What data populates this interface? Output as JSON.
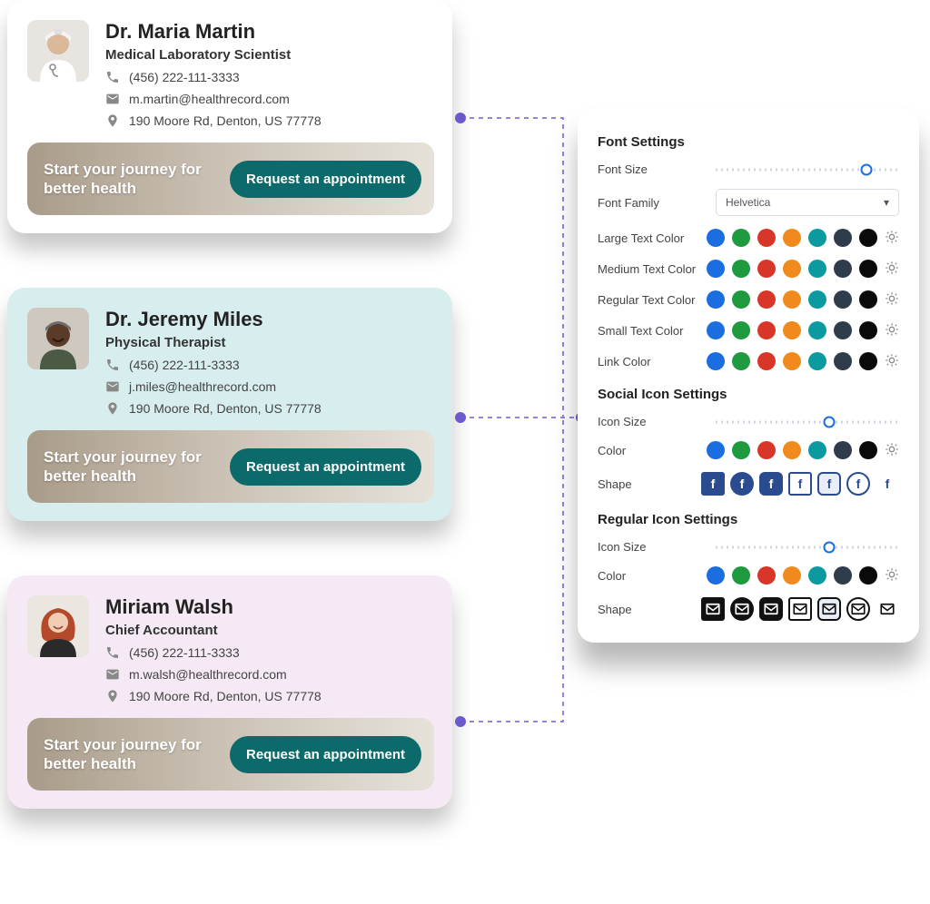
{
  "cards": [
    {
      "bg": "white",
      "name": "Dr. Maria Martin",
      "title": "Medical Laboratory Scientist",
      "phone": "(456) 222-111-3333",
      "email": "m.martin@healthrecord.com",
      "address": "190 Moore Rd, Denton, US 77778",
      "banner_tagline": "Start your journey for better health",
      "banner_cta": "Request an appointment"
    },
    {
      "bg": "blue",
      "name": "Dr. Jeremy Miles",
      "title": "Physical Therapist",
      "phone": "(456) 222-111-3333",
      "email": "j.miles@healthrecord.com",
      "address": "190 Moore Rd, Denton, US 77778",
      "banner_tagline": "Start your journey for better health",
      "banner_cta": "Request an appointment"
    },
    {
      "bg": "pink",
      "name": "Miriam Walsh",
      "title": "Chief Accountant",
      "phone": "(456) 222-111-3333",
      "email": "m.walsh@healthrecord.com",
      "address": "190 Moore Rd, Denton, US 77778",
      "banner_tagline": "Start your journey for better health",
      "banner_cta": "Request an appointment"
    }
  ],
  "settings": {
    "font": {
      "heading": "Font Settings",
      "size_label": "Font Size",
      "family_label": "Font Family",
      "family_value": "Helvetica",
      "large_label": "Large Text Color",
      "medium_label": "Medium Text Color",
      "regular_label": "Regular Text Color",
      "small_label": "Small Text Color",
      "link_label": "Link Color"
    },
    "social": {
      "heading": "Social Icon Settings",
      "size_label": "Icon Size",
      "color_label": "Color",
      "shape_label": "Shape"
    },
    "regular": {
      "heading": "Regular Icon Settings",
      "size_label": "Icon Size",
      "color_label": "Color",
      "shape_label": "Shape"
    },
    "swatch_colors": [
      "#1a6ee0",
      "#1f9a3f",
      "#d9362a",
      "#f08a1d",
      "#0b9aa0",
      "#2f3c4b",
      "#0a0a0a"
    ]
  }
}
